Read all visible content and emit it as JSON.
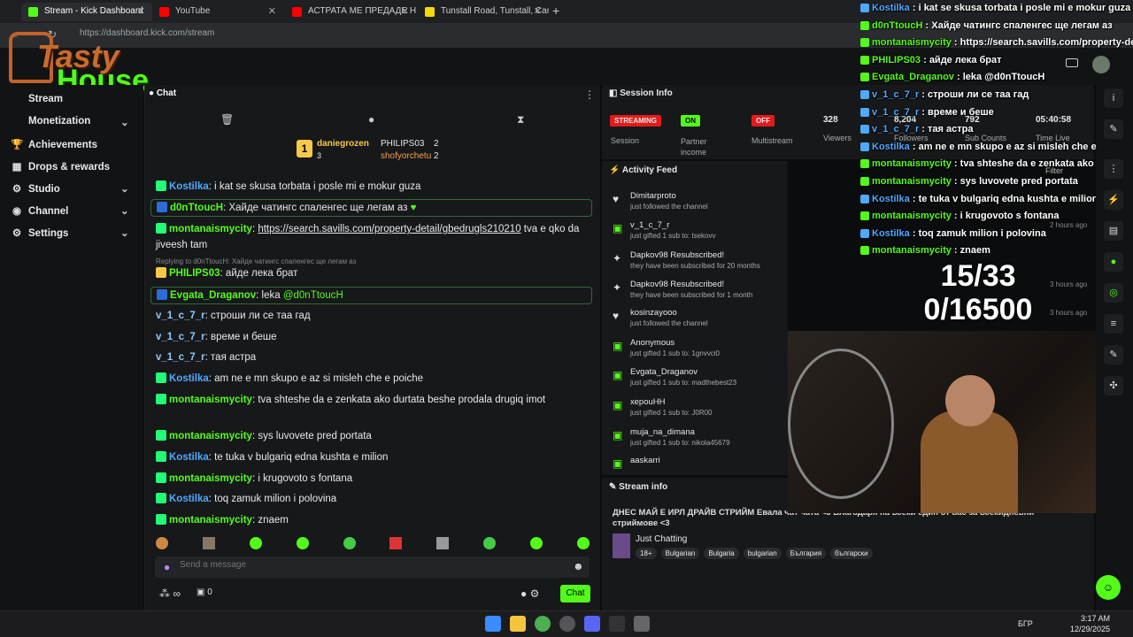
{
  "tabs": [
    {
      "label": "Stream - Kick Dashboard"
    },
    {
      "label": "YouTube"
    },
    {
      "label": "АСТРАТА МЕ ПРЕДАДЕ НА ПЪ"
    },
    {
      "label": "Tunstall Road, Tunstall, Camfor"
    }
  ],
  "url": "https://dashboard.kick.com/stream",
  "logo": {
    "line1": "Tasty",
    "line2": "House"
  },
  "sidebar": {
    "items": [
      {
        "label": "Stream"
      },
      {
        "label": "Monetization"
      },
      {
        "label": "Achievements"
      },
      {
        "label": "Drops & rewards"
      },
      {
        "label": "Studio"
      },
      {
        "label": "Channel"
      },
      {
        "label": "Settings"
      }
    ]
  },
  "chat": {
    "title": "Chat",
    "top": [
      {
        "name": "daniegrozen",
        "rank": "1",
        "count": "3"
      },
      {
        "name": "PHILIPS03",
        "count": "2"
      },
      {
        "name": "shofyorchetu",
        "count": "2"
      }
    ],
    "reply_note": "Replying to d0nTtoucH: Хайде чатингс спаленгес ще легам аз",
    "messages": [
      {
        "user": "Kostilka",
        "text": "i kat se skusa torbata i posle mi e mokur guza"
      },
      {
        "user": "d0nTtoucH",
        "text": "Хайде чатингс спаленгес ще легам аз"
      },
      {
        "user": "montanaismycity",
        "link": "https://search.savills.com/property-detail/gbedrugls210210",
        "text": "tva e qko da jiveesh tam"
      },
      {
        "user": "PHILIPS03",
        "text": "айде лека брат"
      },
      {
        "user": "Evgata_Draganov",
        "text": "leka ",
        "mention": "@d0nTtoucH"
      },
      {
        "user": "v_1_c_7_r",
        "text": "строши ли се таа гад"
      },
      {
        "user": "v_1_c_7_r",
        "text": "време и беше"
      },
      {
        "user": "v_1_c_7_r",
        "text": "тая астра"
      },
      {
        "user": "Kostilka",
        "text": "am ne e mn skupo e az si misleh che e poiche"
      },
      {
        "user": "montanaismycity",
        "text": "tva shteshe da e zenkata ako durtata beshe prodala drugiq imot"
      },
      {
        "user": "montanaismycity",
        "text": "sys luvovete pred portata"
      },
      {
        "user": "Kostilka",
        "text": "te tuka v bulgariq edna kushta e milion"
      },
      {
        "user": "montanaismycity",
        "text": "i krugovoto s fontana"
      },
      {
        "user": "Kostilka",
        "text": "toq zamuk milion i polovina"
      },
      {
        "user": "montanaismycity",
        "text": "znaem"
      }
    ],
    "input_placeholder": "Send a message",
    "footer": {
      "count": "0",
      "send": "Chat"
    }
  },
  "session": {
    "title": "Session Info",
    "streaming": "STREAMING",
    "session_label": "Session",
    "partner_val": "ON",
    "partner_label": "Partner income",
    "multistream_val": "OFF",
    "multistream_label": "Multistream",
    "viewers": "328",
    "viewers_label": "Viewers",
    "followers": "8,204",
    "followers_label": "Followers",
    "subs": "792",
    "subs_label": "Sub Counts",
    "time": "05:40:58",
    "time_label": "Time Live"
  },
  "activity": {
    "title": "Activity Feed",
    "filter": "Filter",
    "items": [
      {
        "name": "Dimitarproto",
        "sub": "just followed the channel",
        "time": ""
      },
      {
        "name": "v_1_c_7_r",
        "sub": "just gifted 1 sub to: tsekovv",
        "time": "2 hours ago"
      },
      {
        "name": "Dapkov98 Resubscribed!",
        "sub": "they have been subscribed for 20 months",
        "time": ""
      },
      {
        "name": "Dapkov98 Resubscribed!",
        "sub": "they have been subscribed for 1 month",
        "time": "3 hours ago"
      },
      {
        "name": "kosinzayooo",
        "sub": "just followed the channel",
        "time": "3 hours ago"
      },
      {
        "name": "Anonymous",
        "sub": "just gifted 1 sub to: 1gnvvci0",
        "time": ""
      },
      {
        "name": "Evgata_Draganov",
        "sub": "just gifted 1 sub to: madthebest23",
        "time": ""
      },
      {
        "name": "хероuHH",
        "sub": "just gifted 1 sub to: J0R00",
        "time": ""
      },
      {
        "name": "muja_na_dimana",
        "sub": "just gifted 1 sub to: nikola45679",
        "time": ""
      },
      {
        "name": "aaskarri",
        "sub": "",
        "time": ""
      }
    ]
  },
  "streaminfo": {
    "title": "Stream info",
    "stream_title": "ДНЕС МАЙ Е ИРЛ ДРАЙВ СТРИЙМ Евала чат чата <3 Благодаря на всеки един от вас за всекидневни стриймове <3",
    "category": "Just Chatting",
    "tags": [
      "18+",
      "Bulgarian",
      "Bulgaria",
      "bulgarian",
      "България",
      "български"
    ]
  },
  "overlay": {
    "messages": [
      {
        "user": "Kostilka",
        "text": "i kat se skusa torbata i posle mi e mokur guza"
      },
      {
        "user": "d0nTtoucH",
        "text": "Хайде чатингс спаленгес ще легам аз"
      },
      {
        "user": "montanaismycity",
        "text": "https://search.savills.com/property-de"
      },
      {
        "user": "PHILIPS03",
        "text": "айде лека брат"
      },
      {
        "user": "Evgata_Draganov",
        "text": "leka @d0nTtoucH"
      },
      {
        "user": "v_1_c_7_r",
        "text": "строши ли се таа гад"
      },
      {
        "user": "v_1_c_7_r",
        "text": "време и беше"
      },
      {
        "user": "v_1_c_7_r",
        "text": "тая астра"
      },
      {
        "user": "Kostilka",
        "text": "am ne e mn skupo e az si misleh che e poiche"
      },
      {
        "user": "montanaismycity",
        "text": "tva shteshe da e zenkata ako durtata be"
      },
      {
        "user": "montanaismycity",
        "text": "sys luvovete pred portata"
      },
      {
        "user": "Kostilka",
        "text": "te tuka v bulgariq edna kushta e milion"
      },
      {
        "user": "montanaismycity",
        "text": "i krugovoto s fontana"
      },
      {
        "user": "Kostilka",
        "text": "toq zamuk milion i polovina"
      },
      {
        "user": "montanaismycity",
        "text": "znaem"
      }
    ],
    "goal_line1": "15/33",
    "goal_line2": "0/16500"
  },
  "taskbar": {
    "time": "3:17 AM",
    "date": "12/29/2025",
    "lang": "БГР"
  },
  "colors": {
    "kick_green": "#53fc18",
    "streaming_red": "#e31b1b",
    "bg": "#17181a"
  }
}
